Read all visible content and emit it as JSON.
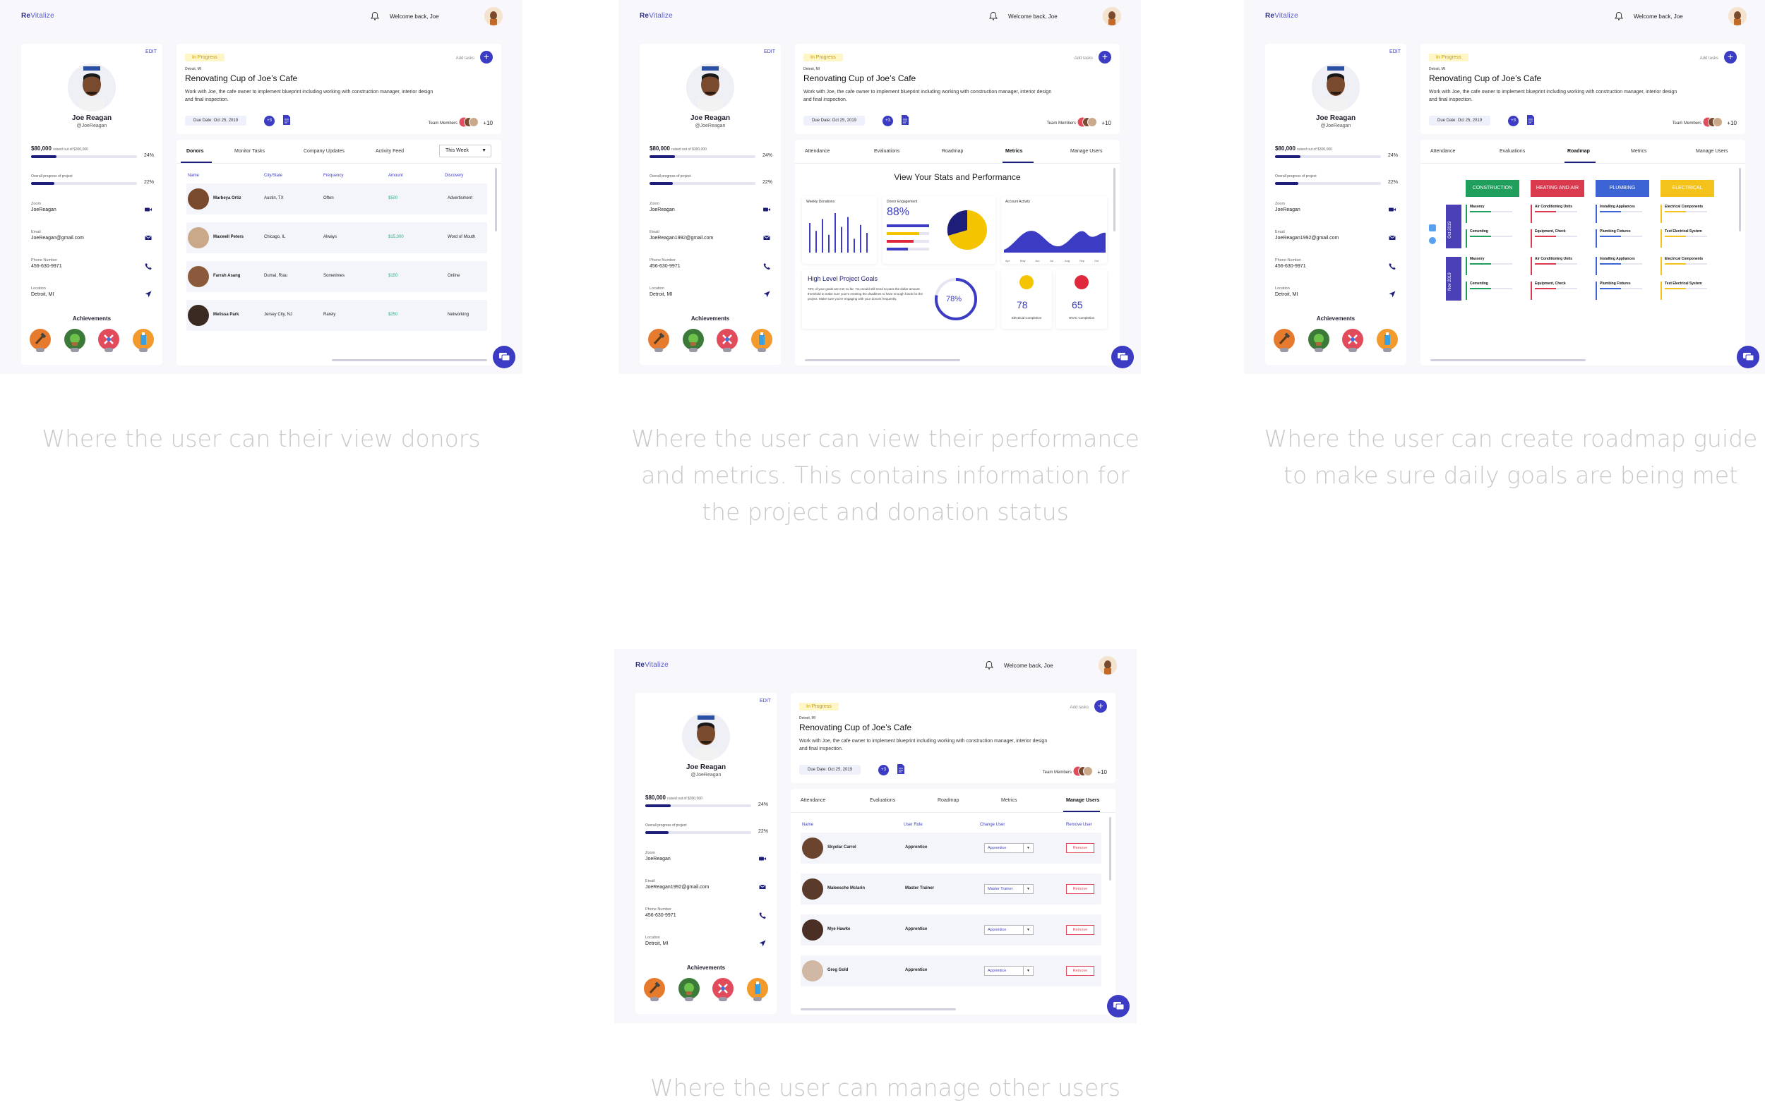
{
  "app": {
    "logo_re": "Re",
    "logo_rest": "Vitalize",
    "welcome": "Welcome back,  Joe"
  },
  "profile": {
    "edit": "EDIT",
    "name": "Joe Reagan",
    "handle": "@JoeReagan",
    "raised_amount": "$80,000",
    "raised_suffix": "raised out of $300,000",
    "raised_pct": "24%",
    "raised_fraction": 0.24,
    "overall_label": "Overall progress of project",
    "overall_pct": "22%",
    "overall_fraction": 0.22,
    "zoom_label": "Zoom",
    "zoom_value": "JoeReagan",
    "email_label": "Email",
    "email_value_donors": "JoeReagan@gmail.com",
    "email_value": "JoeReagan1992@gmail.com",
    "phone_label": "Phone Number",
    "phone_value": "456-630-9971",
    "location_label": "Location",
    "location_value": "Detroit, MI",
    "achievements_title": "Achievements",
    "badge_colors": [
      "#e77b2d",
      "#3c7a3a",
      "#e24b5b",
      "#f29a2b"
    ]
  },
  "project": {
    "status": "In Progress",
    "location": "Detroit, MI",
    "title": "Renovating Cup of Joe’s Cafe",
    "description": "Work with Joe, the cafe owner to implement blueprint including working with construction manager, interior design and final inspection.",
    "due": "Due Date: Oct 25, 2019",
    "plus_count": "+3",
    "add_tasks": "Add tasks",
    "team_label": "Team Members",
    "team_more": "+10"
  },
  "donors_view": {
    "tabs": [
      "Donors",
      "Monitor Tasks",
      "Company Updates",
      "Activity Feed"
    ],
    "filter": "This Week",
    "columns": [
      "Name",
      "City/State",
      "Frequency",
      "Amount",
      "Discovery"
    ],
    "rows": [
      {
        "name": "Marbeya Ortiz",
        "city": "Austin, TX",
        "freq": "Often",
        "amount": "$500",
        "disc": "Advertisment",
        "skin": "#7a4a2e"
      },
      {
        "name": "Maxwell Peters",
        "city": "Chicago, IL",
        "freq": "Always",
        "amount": "$15,300",
        "disc": "Word of Mouth",
        "skin": "#c9a98a"
      },
      {
        "name": "Farrah Asang",
        "city": "Dumai, Riau",
        "freq": "Sometimes",
        "amount": "$150",
        "disc": "Online",
        "skin": "#8b5a3c"
      },
      {
        "name": "Melissa Park",
        "city": "Jersey City, NJ",
        "freq": "Rarely",
        "amount": "$250",
        "disc": "Networking",
        "skin": "#3a2a22"
      }
    ]
  },
  "metric_tabs": [
    "Attendance",
    "Evaluations",
    "Roadmap",
    "Metrics",
    "Manage Users"
  ],
  "metrics_view": {
    "title": "View Your Stats and Performance",
    "weekly_donations": "Weekly Donations",
    "donor_engagement": "Donor Engagement",
    "engagement_pct": "88%",
    "account_activity": "Account Activity",
    "goals_title": "High Level Project Goals",
    "goals_text": "78% of your goals are met so far. You would still need to pass the dollar amount threshold to make sure you're meeting the deadlines to have enough funds for the project. Make sure you're engaging with your donors frequently.",
    "goals_pct": "78%",
    "goals_fraction": 0.78,
    "electrical_value": "78",
    "electrical_label": "Electrical  Completion",
    "hvac_value": "65",
    "hvac_label": "HVAC Completion",
    "activity_months": [
      "Apr",
      "May",
      "Jun",
      "Jul",
      "Aug",
      "Sep",
      "Oct"
    ],
    "accent_blue": "#3b3bc4",
    "accent_yellow": "#f5c400",
    "accent_red": "#e0283c"
  },
  "roadmap_view": {
    "categories": [
      {
        "label": "CONSTRUCTION",
        "color": "#1f9e5c"
      },
      {
        "label": "HEATING AND AIR",
        "color": "#d93a4e"
      },
      {
        "label": "PLUMBING",
        "color": "#3d64d4"
      },
      {
        "label": "ELECTRICAL",
        "color": "#f3c21b"
      }
    ],
    "months": [
      "Oct 2019",
      "Nov 2019"
    ],
    "items": [
      [
        "Masonry",
        "Air Conditioning Units",
        "Installing Appliances",
        "Electrical Components"
      ],
      [
        "Cementing",
        "Equipment, Check",
        "Plumbing Fixtures",
        "Test Electrical System"
      ],
      [
        "Masonry",
        "Air Conditioning Units",
        "Installing Appliances",
        "Electrical Components"
      ],
      [
        "Cementing",
        "Equipment, Check",
        "Plumbing Fixtures",
        "Test Electrical System"
      ]
    ]
  },
  "users_view": {
    "columns": [
      "Name",
      "User Role",
      "Change User",
      "Remove User"
    ],
    "remove_label": "Remove",
    "rows": [
      {
        "name": "Skyelar Carrol",
        "role": "Apprentice",
        "select": "Apprentice",
        "skin": "#6b4430"
      },
      {
        "name": "Maleesche Mclarin",
        "role": "Master Trainer",
        "select": "Master Trainer",
        "skin": "#5a3a2a"
      },
      {
        "name": "Mye Hawke",
        "role": "Apprentice",
        "select": "Apprentice",
        "skin": "#4a2f25"
      },
      {
        "name": "Greg Gold",
        "role": "Apprentice",
        "select": "Apprentice",
        "skin": "#d0b8a4"
      }
    ]
  },
  "captions": {
    "donors": "Where the user can their view donors",
    "metrics": "Where the user can view their performance and metrics. This contains information for the project and donation status",
    "roadmap": "Where the user can create roadmap guide to make sure daily goals are being met",
    "users": "Where the user can manage other users"
  }
}
